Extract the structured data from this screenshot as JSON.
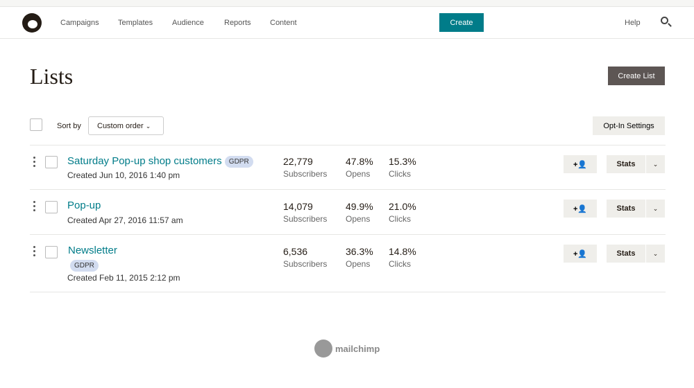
{
  "nav": {
    "items": [
      "Campaigns",
      "Templates",
      "Audience",
      "Reports",
      "Content"
    ],
    "create": "Create",
    "help": "Help"
  },
  "page": {
    "title": "Lists",
    "create_list": "Create List",
    "sort_label": "Sort by",
    "sort_value": "Custom order",
    "optin": "Opt-In Settings"
  },
  "lists": [
    {
      "name": "Saturday Pop-up shop customers",
      "gdpr": "GDPR",
      "created": "Created Jun 10, 2016 1:40 pm",
      "subscribers": "22,779",
      "opens": "47.8%",
      "clicks": "15.3%"
    },
    {
      "name": "Pop-up",
      "created": "Created Apr 27, 2016 11:57 am",
      "subscribers": "14,079",
      "opens": "49.9%",
      "clicks": "21.0%"
    },
    {
      "name": "Newsletter",
      "gdpr": "GDPR",
      "created": "Created Feb 11, 2015 2:12 pm",
      "subscribers": "6,536",
      "opens": "36.3%",
      "clicks": "14.8%"
    }
  ],
  "labels": {
    "subscribers": "Subscribers",
    "opens": "Opens",
    "clicks": "Clicks",
    "stats": "Stats",
    "add_icon": "+👤"
  },
  "footer": {
    "brand": "mailchimp"
  }
}
